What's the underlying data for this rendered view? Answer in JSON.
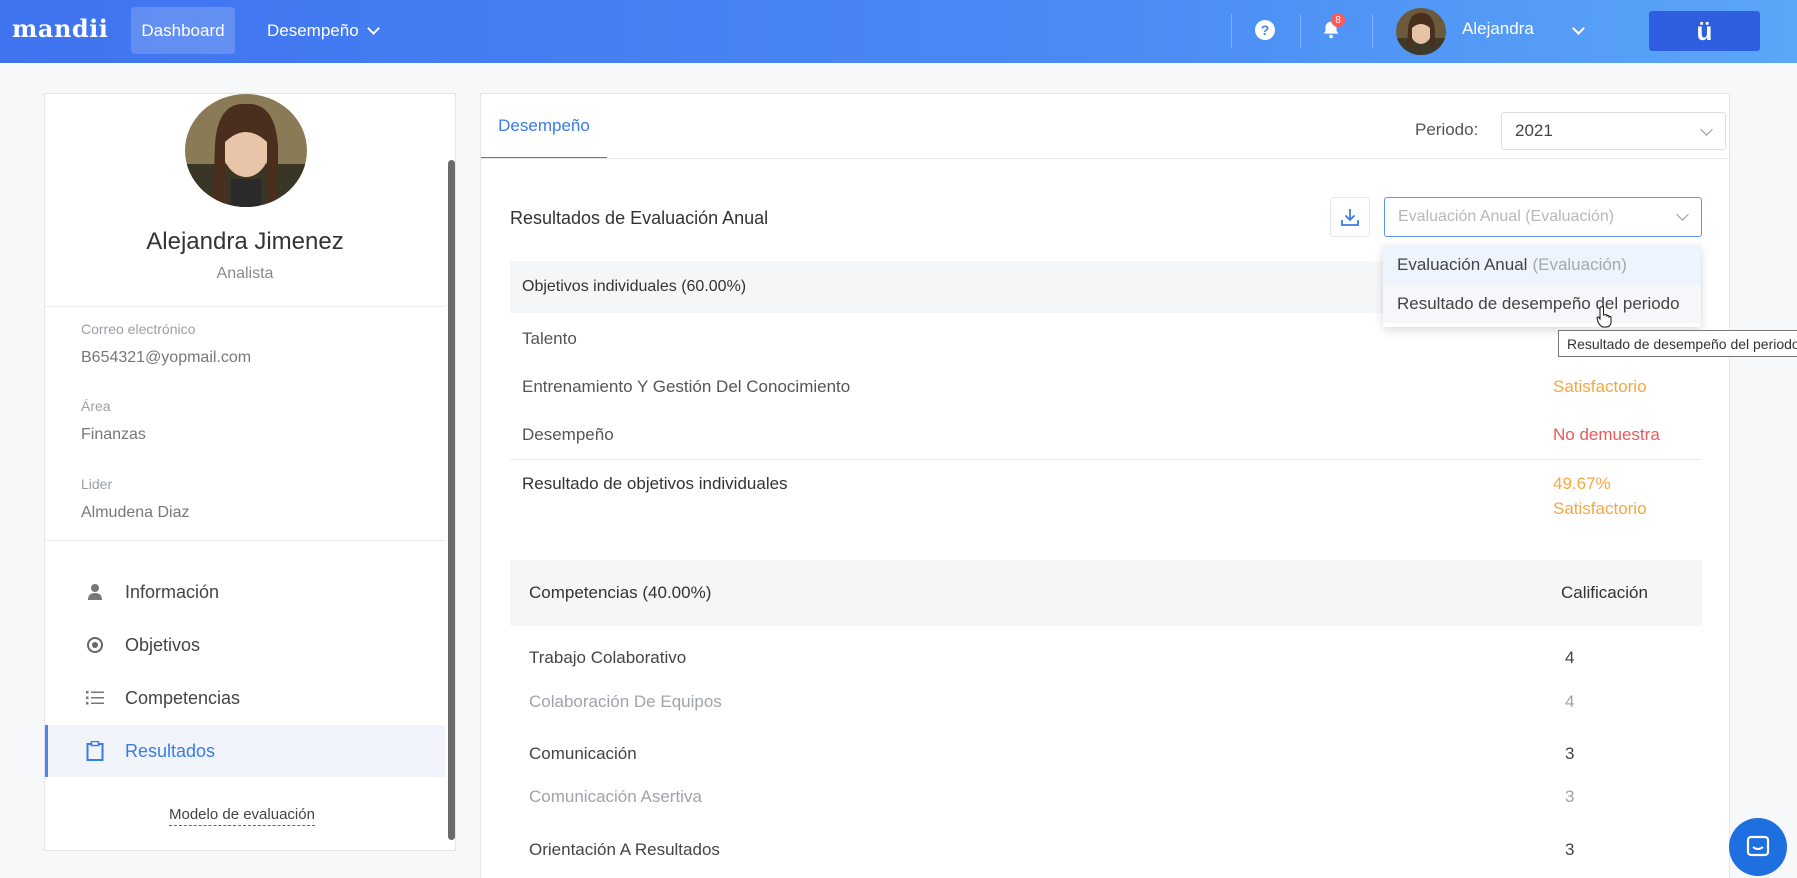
{
  "header": {
    "logo": "mandii",
    "nav": [
      {
        "label": "Dashboard"
      },
      {
        "label": "Desempeño"
      }
    ],
    "notifications_count": "8",
    "user_name": "Alejandra",
    "brand_button": "ü"
  },
  "profile": {
    "name": "Alejandra Jimenez",
    "role": "Analista",
    "fields": [
      {
        "label": "Correo electrónico",
        "value": "B654321@yopmail.com"
      },
      {
        "label": "Área",
        "value": "Finanzas"
      },
      {
        "label": "Lider",
        "value": "Almudena Diaz"
      }
    ],
    "menu": [
      {
        "label": "Información",
        "icon": "user-icon"
      },
      {
        "label": "Objetivos",
        "icon": "target-icon"
      },
      {
        "label": "Competencias",
        "icon": "list-icon"
      },
      {
        "label": "Resultados",
        "icon": "clipboard-icon",
        "active": true
      }
    ],
    "model_link": "Modelo de evaluación"
  },
  "main": {
    "tab": "Desempeño",
    "period_label": "Periodo:",
    "period_value": "2021",
    "section_title": "Resultados de Evaluación Anual",
    "eval_select_value": "Evaluación Anual (Evaluación)",
    "objectives_header": "Objetivos individuales (60.00%)",
    "objectives": [
      {
        "label": "Talento",
        "value": ""
      },
      {
        "label": "Entrenamiento Y Gestión Del Conocimiento",
        "value": "Satisfactorio"
      },
      {
        "label": "Desempeño",
        "value": "No demuestra"
      }
    ],
    "objectives_result": {
      "label": "Resultado de objetivos individuales",
      "percent": "49.67%",
      "rating": "Satisfactorio"
    },
    "competencies_header": "Competencias (40.00%)",
    "competencies_col": "Calificación",
    "competencies": [
      {
        "label": "Trabajo Colaborativo",
        "value": "4",
        "type": "main"
      },
      {
        "label": "Colaboración De Equipos",
        "value": "4",
        "type": "sub"
      },
      {
        "label": "Comunicación",
        "value": "3",
        "type": "main"
      },
      {
        "label": "Comunicación Asertiva",
        "value": "3",
        "type": "sub"
      },
      {
        "label": "Orientación A Resultados",
        "value": "3",
        "type": "main"
      }
    ]
  },
  "dropdown": {
    "options": [
      {
        "main": "Evaluación Anual",
        "sub": "(Evaluación)"
      },
      {
        "main": "Resultado de desempeño del periodo",
        "sub": ""
      }
    ],
    "tooltip": "Resultado de desempeño del periodo"
  },
  "colors": {
    "accent": "#3a7be6",
    "satisfactorio": "#f5a742",
    "no_demuestra": "#e85a5a"
  }
}
